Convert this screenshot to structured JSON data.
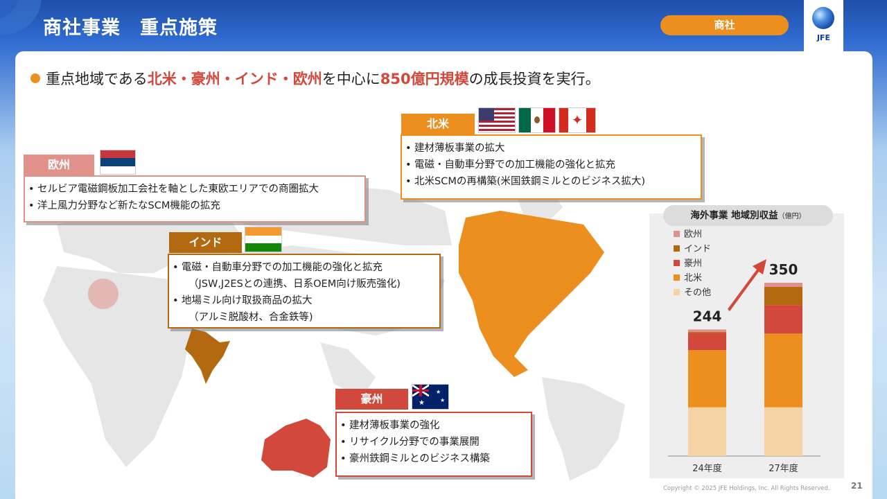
{
  "header": {
    "title": "商社事業　重点施策",
    "badge": "商社",
    "logo_text": "JFE"
  },
  "lead": {
    "p1": "重点地域である",
    "p2": "北米・豪州・インド・欧州",
    "p3": "を中心に",
    "p4": "850億円規模",
    "p5": "の成長投資を実行。"
  },
  "regions": {
    "europe": {
      "label": "欧州",
      "items": [
        "セルビア電磁鋼板加工会社を軸とした東欧エリアでの商圏拡大",
        "洋上風力分野など新たなSCM機能の拡充"
      ]
    },
    "india": {
      "label": "インド",
      "items": [
        {
          "main": "電磁・自動車分野での加工機能の強化と拡充",
          "sub": "（JSW,J2ESとの連携、日系OEM向け販売強化)"
        },
        {
          "main": "地場ミル向け取扱商品の拡大",
          "sub": "（アルミ脱酸材、合金鉄等)"
        }
      ]
    },
    "north_america": {
      "label": "北米",
      "items": [
        "建材薄板事業の拡大",
        "電磁・自動車分野での加工機能の強化と拡充",
        "北米SCMの再構築(米国鉄鋼ミルとのビジネス拡大)"
      ]
    },
    "australia": {
      "label": "豪州",
      "items": [
        "建材薄板事業の強化",
        "リサイクル分野での事業展開",
        "豪州鉄鋼ミルとのビジネス構築"
      ]
    }
  },
  "colors": {
    "accent": "#ec8f1e",
    "europe": "#e0918a",
    "india": "#b2690f",
    "north_america": "#ec8f1e",
    "australia": "#d2483a",
    "other": "#f6d3a4"
  },
  "chart_data": {
    "type": "bar",
    "stacked": true,
    "title": "海外事業 地域別収益",
    "unit": "（億円）",
    "categories": [
      "24年度",
      "27年度"
    ],
    "totals": [
      244,
      350
    ],
    "ylim": [
      0,
      350
    ],
    "series": [
      {
        "name": "その他",
        "color": "#f6d3a4",
        "values": [
          94,
          94
        ]
      },
      {
        "name": "北米",
        "color": "#ec8f1e",
        "values": [
          110,
          142
        ]
      },
      {
        "name": "豪州",
        "color": "#d2483a",
        "values": [
          33,
          55
        ]
      },
      {
        "name": "インド",
        "color": "#b2690f",
        "values": [
          2,
          35
        ]
      },
      {
        "name": "欧州",
        "color": "#e0918a",
        "values": [
          5,
          8
        ]
      }
    ],
    "legend_order": [
      "欧州",
      "インド",
      "豪州",
      "北米",
      "その他"
    ]
  },
  "footer": {
    "copyright": "Copyright © 2025 JFE Holdings, Inc. All Rights Reserved.",
    "page": "21"
  }
}
